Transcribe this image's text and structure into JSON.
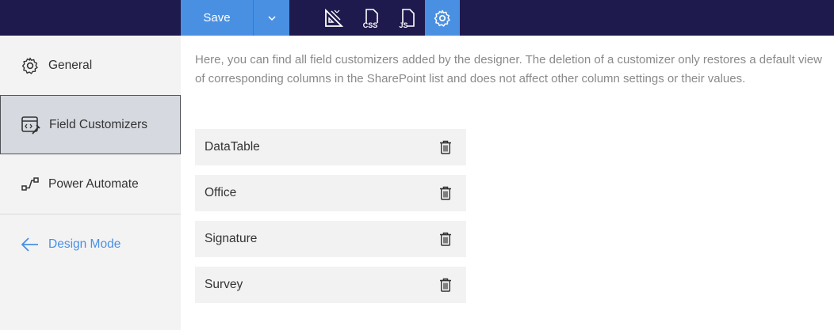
{
  "toolbar": {
    "save_label": "Save",
    "buttons": [
      "layout-icon",
      "css-icon",
      "js-icon",
      "gear-icon"
    ]
  },
  "sidebar": {
    "items": [
      {
        "label": "General",
        "icon": "gear-icon"
      },
      {
        "label": "Field Customizers",
        "icon": "field-customizer-icon",
        "selected": true
      },
      {
        "label": "Power Automate",
        "icon": "flow-icon"
      },
      {
        "label": "Design Mode",
        "icon": "arrow-left-icon"
      }
    ]
  },
  "main": {
    "description": "Here, you can find all field customizers added by the designer. The deletion of a customizer only restores a default view of corresponding columns in the SharePoint list and does not affect other column settings or their values.",
    "customizers": [
      {
        "name": "DataTable"
      },
      {
        "name": "Office"
      },
      {
        "name": "Signature"
      },
      {
        "name": "Survey"
      }
    ]
  },
  "colors": {
    "topbar": "#1f1a4d",
    "accent": "#4a90e2",
    "sidebar_bg": "#f3f3f4",
    "row_bg": "#f2f2f3"
  }
}
